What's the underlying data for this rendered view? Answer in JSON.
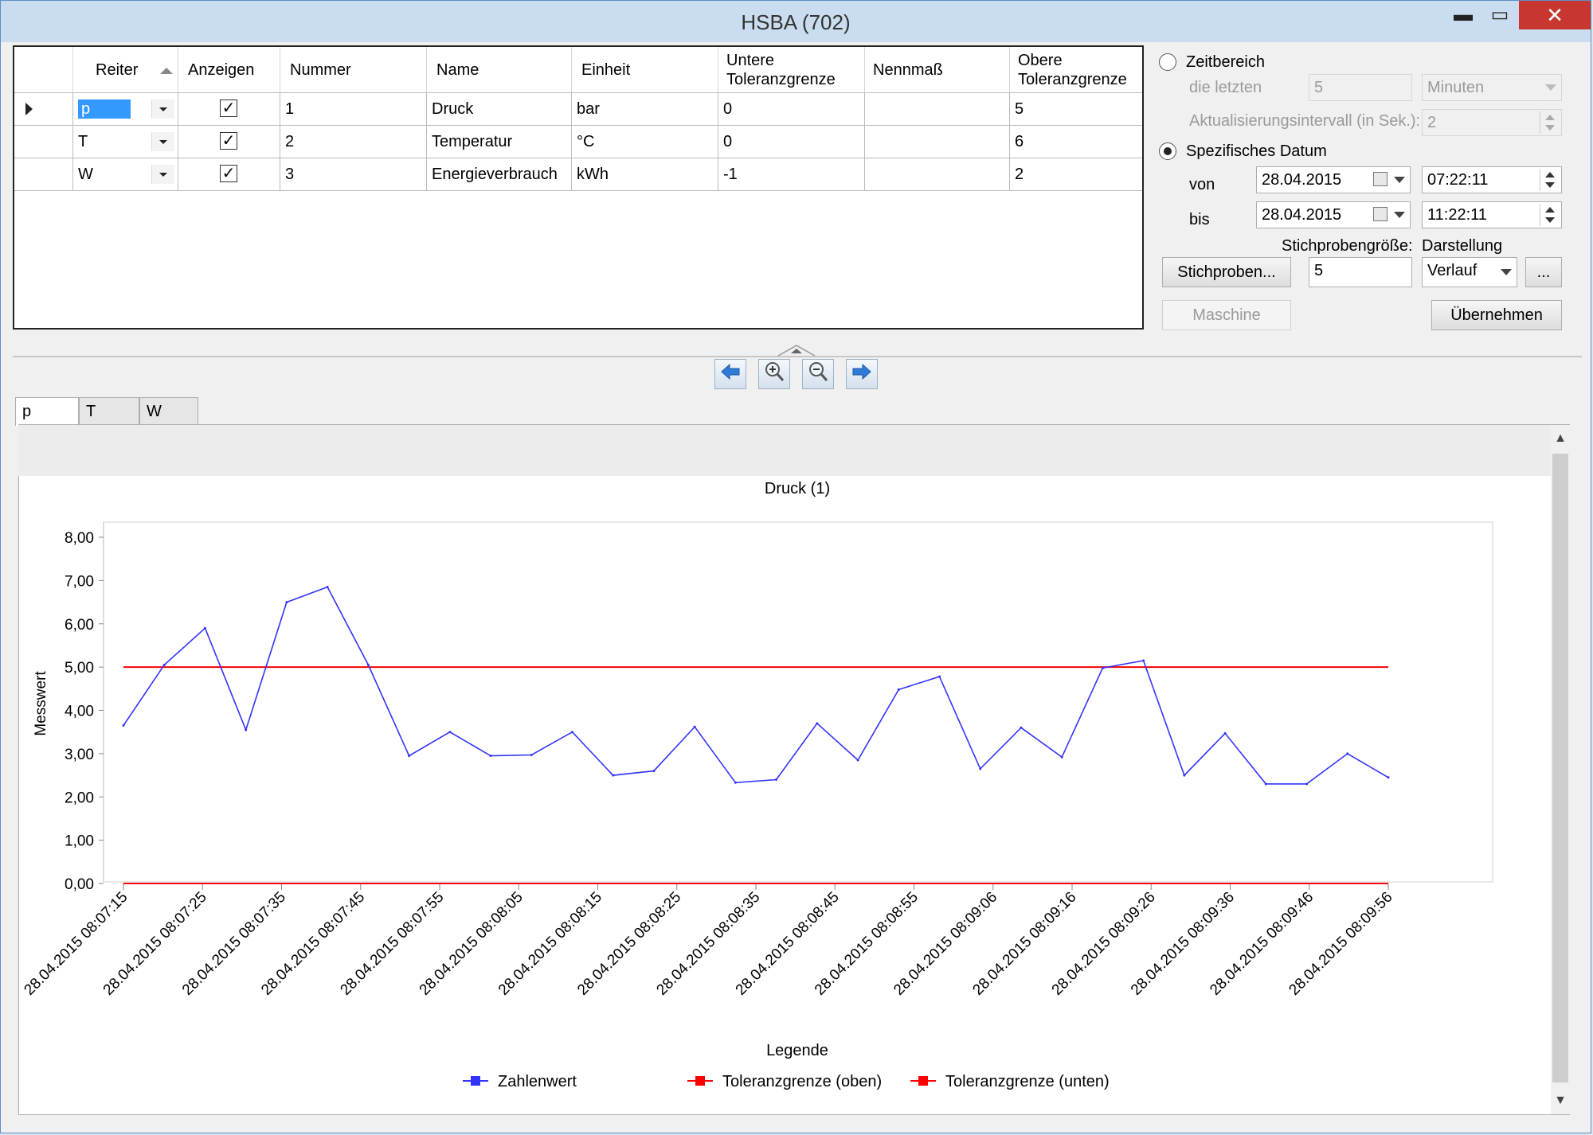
{
  "window": {
    "title": "HSBA (702)",
    "minimize": "▬",
    "maximize": "▭",
    "close": "✕"
  },
  "grid": {
    "headers": {
      "reiter": "Reiter",
      "anzeigen": "Anzeigen",
      "nummer": "Nummer",
      "name": "Name",
      "einheit": "Einheit",
      "untere": "Untere Toleranzgrenze",
      "nennmass": "Nennmaß",
      "obere": "Obere Toleranzgrenze"
    },
    "rows": [
      {
        "reiter": "p",
        "anzeigen": "✓",
        "nummer": "1",
        "name": "Druck",
        "einheit": "bar",
        "untere": "0",
        "nennmass": "",
        "obere": "5"
      },
      {
        "reiter": "T",
        "anzeigen": "✓",
        "nummer": "2",
        "name": "Temperatur",
        "einheit": "°C",
        "untere": "0",
        "nennmass": "",
        "obere": "6"
      },
      {
        "reiter": "W",
        "anzeigen": "✓",
        "nummer": "3",
        "name": "Energieverbrauch",
        "einheit": "kWh",
        "untere": "-1",
        "nennmass": "",
        "obere": "2"
      }
    ]
  },
  "panel": {
    "zeitbereich": "Zeitbereich",
    "die_letzten": "die letzten",
    "letzten_value": "5",
    "unit_value": "Minuten",
    "aktualisierung": "Aktualisierungsintervall (in Sek.):",
    "aktualisierung_value": "2",
    "spezifisch": "Spezifisches Datum",
    "von": "von",
    "bis": "bis",
    "von_date": "28.04.2015",
    "von_time": "07:22:11",
    "bis_date": "28.04.2015",
    "bis_time": "11:22:11",
    "stichprobengroesse": "Stichprobengröße:",
    "darstellung": "Darstellung",
    "stichproben_button": "Stichproben...",
    "stichproben_value": "5",
    "darstellung_value": "Verlauf",
    "more_button": "...",
    "maschine_button": "Maschine",
    "uebernehmen_button": "Übernehmen"
  },
  "tabs": [
    "p",
    "T",
    "W"
  ],
  "chart_data": {
    "type": "line",
    "title": "Druck (1)",
    "xlabel": "",
    "ylabel": "Messwert",
    "ylim": [
      0,
      8
    ],
    "yticks": [
      "0,00",
      "1,00",
      "2,00",
      "3,00",
      "4,00",
      "5,00",
      "6,00",
      "7,00",
      "8,00"
    ],
    "xticks": [
      "28.04.2015 08:07:15",
      "28.04.2015 08:07:25",
      "28.04.2015 08:07:35",
      "28.04.2015 08:07:45",
      "28.04.2015 08:07:55",
      "28.04.2015 08:08:05",
      "28.04.2015 08:08:15",
      "28.04.2015 08:08:25",
      "28.04.2015 08:08:35",
      "28.04.2015 08:08:45",
      "28.04.2015 08:08:55",
      "28.04.2015 08:09:06",
      "28.04.2015 08:09:16",
      "28.04.2015 08:09:26",
      "28.04.2015 08:09:36",
      "28.04.2015 08:09:46",
      "28.04.2015 08:09:56"
    ],
    "series": [
      {
        "name": "Zahlenwert",
        "color": "#3333ff",
        "values": [
          3.65,
          5.05,
          5.9,
          3.55,
          6.5,
          6.85,
          5.05,
          2.95,
          3.5,
          2.95,
          2.97,
          3.5,
          2.5,
          2.6,
          3.62,
          2.33,
          2.4,
          3.7,
          2.85,
          4.48,
          4.78,
          2.65,
          3.6,
          2.92,
          4.98,
          5.15,
          2.5,
          3.47,
          2.3,
          2.3,
          3.0,
          2.45
        ]
      },
      {
        "name": "Toleranzgrenze (oben)",
        "color": "#ff0000",
        "value": 5
      },
      {
        "name": "Toleranzgrenze (unten)",
        "color": "#ff0000",
        "value": 0
      }
    ],
    "legend_title": "Legende",
    "legend_position": "bottom"
  }
}
